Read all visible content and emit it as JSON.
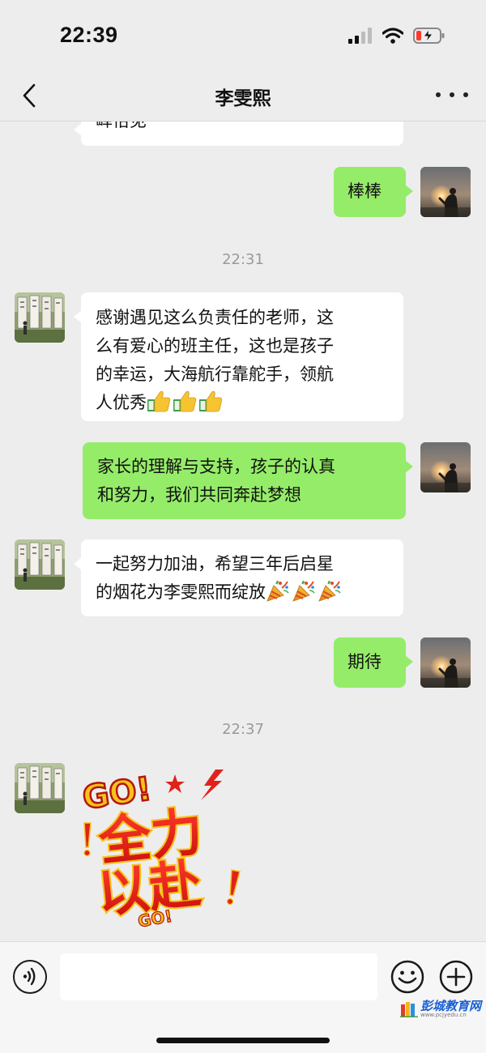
{
  "status_bar": {
    "time": "22:39"
  },
  "header": {
    "title": "李雯熙"
  },
  "timestamps": [
    "22:31",
    "22:37"
  ],
  "messages": [
    {
      "from": "contact",
      "text": "峄恰见"
    },
    {
      "from": "me",
      "text": "棒棒"
    },
    {
      "from": "contact",
      "lines": [
        "感谢遇见这么负责任的老师，这",
        "么有爱心的班主任，这也是孩子",
        "的幸运，大海航行靠舵手，领航",
        "人优秀"
      ],
      "emojis": [
        "thumbs-up-icon",
        "thumbs-up-icon",
        "thumbs-up-icon"
      ]
    },
    {
      "from": "me",
      "lines": [
        "家长的理解与支持，孩子的认真",
        "和努力，我们共同奔赴梦想"
      ]
    },
    {
      "from": "contact",
      "lines": [
        "一起努力加油，希望三年后启星",
        "的烟花为李雯熙而绽放"
      ],
      "emojis": [
        "party-popper-icon",
        "party-popper-icon",
        "party-popper-icon"
      ]
    },
    {
      "from": "me",
      "text": "期待"
    },
    {
      "from": "contact",
      "sticker": {
        "top": "GO!",
        "line1": "全力",
        "line2": "以赴",
        "bottom": "GO!"
      }
    }
  ],
  "watermark": {
    "title": "彭城教育网",
    "url": "www.pcjyedu.cn"
  },
  "colors": {
    "background": "#ededed",
    "incoming_bubble": "#ffffff",
    "outgoing_bubble": "#95ec69",
    "timestamp": "#9a9a9a"
  }
}
